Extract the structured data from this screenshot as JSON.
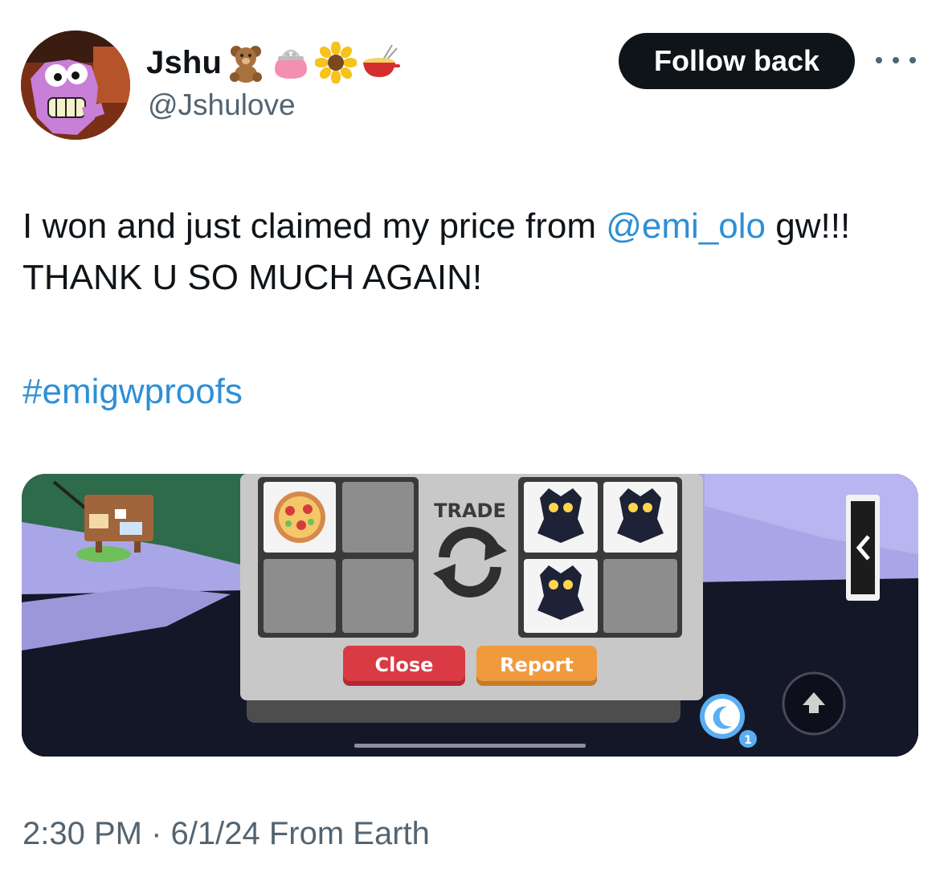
{
  "author": {
    "display_name": "Jshu",
    "handle": "@Jshulove",
    "name_emojis": [
      "teddy-bear-icon",
      "purse-icon",
      "sunflower-icon",
      "fondue-icon"
    ]
  },
  "follow_button": {
    "label": "Follow back"
  },
  "more_menu": {
    "icon": "more-horizontal-icon"
  },
  "tweet": {
    "text_before": "I won and just claimed my price from ",
    "mention": "@emi_olo",
    "text_after": " gw!!! THANK U SO MUCH AGAIN!",
    "hashtag": "#emigwproofs"
  },
  "media": {
    "trade_title": "TRADE",
    "close_label": "Close",
    "report_label": "Report",
    "sleep_badge_count": "1"
  },
  "meta": {
    "time": "2:30 PM",
    "separator": " · ",
    "date": "6/1/24",
    "source": " From Earth"
  },
  "colors": {
    "link": "#2d8fd6",
    "text": "#0f1419",
    "muted": "#536471",
    "close_button": "#d93a44",
    "report_button": "#f09a3e"
  }
}
